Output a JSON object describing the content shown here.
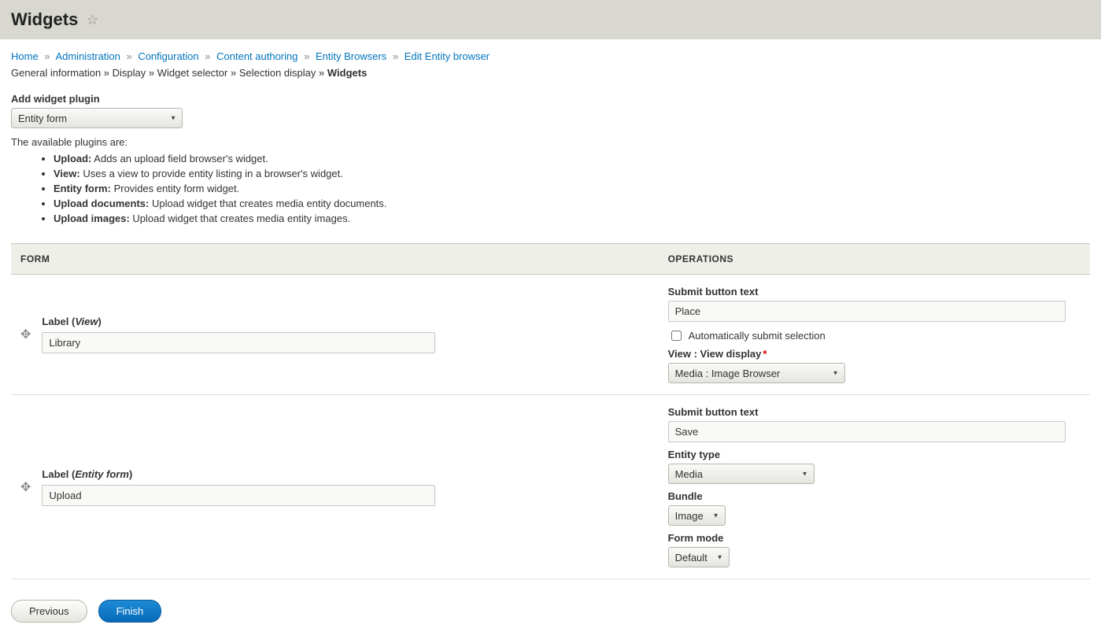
{
  "page_title": "Widgets",
  "breadcrumb": {
    "home": "Home",
    "administration": "Administration",
    "configuration": "Configuration",
    "content_authoring": "Content authoring",
    "entity_browsers": "Entity Browsers",
    "edit": "Edit Entity browser"
  },
  "subnav": {
    "general": "General information",
    "display": "Display",
    "widget_selector": "Widget selector",
    "selection_display": "Selection display",
    "widgets": "Widgets"
  },
  "add_plugin": {
    "label": "Add widget plugin",
    "selected": "Entity form",
    "help_intro": "The available plugins are:",
    "options": [
      {
        "name": "Upload:",
        "desc": "Adds an upload field browser's widget."
      },
      {
        "name": "View:",
        "desc": "Uses a view to provide entity listing in a browser's widget."
      },
      {
        "name": "Entity form:",
        "desc": "Provides entity form widget."
      },
      {
        "name": "Upload documents:",
        "desc": "Upload widget that creates media entity documents."
      },
      {
        "name": "Upload images:",
        "desc": "Upload widget that creates media entity images."
      }
    ]
  },
  "table": {
    "col_form": "FORM",
    "col_ops": "OPERATIONS",
    "label_prefix": "Label ("
  },
  "rows": [
    {
      "type": "View",
      "label_value": "Library",
      "submit_label": "Submit button text",
      "submit_value": "Place",
      "auto_label": "Automatically submit selection",
      "auto_checked": false,
      "view_label": "View : View display",
      "view_value": "Media : Image Browser"
    },
    {
      "type": "Entity form",
      "label_value": "Upload",
      "submit_label": "Submit button text",
      "submit_value": "Save",
      "entity_type_label": "Entity type",
      "entity_type_value": "Media",
      "bundle_label": "Bundle",
      "bundle_value": "Image",
      "form_mode_label": "Form mode",
      "form_mode_value": "Default"
    }
  ],
  "buttons": {
    "previous": "Previous",
    "finish": "Finish"
  }
}
